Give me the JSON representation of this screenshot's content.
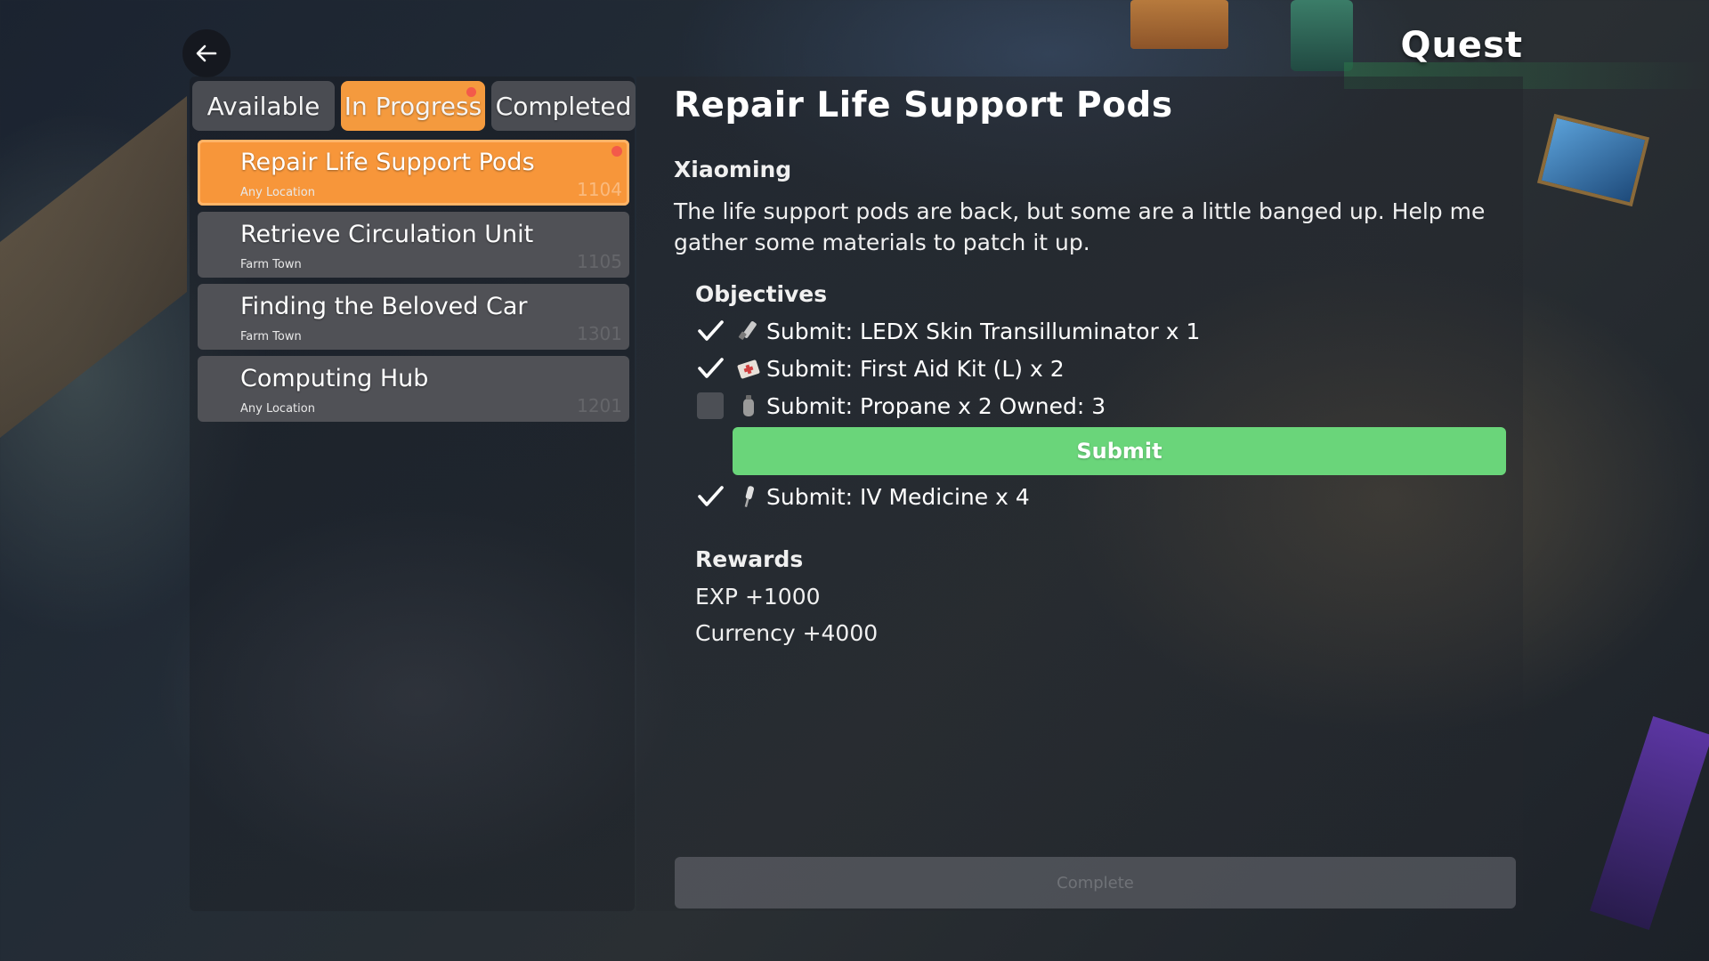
{
  "screen_title": "Quest",
  "tabs": [
    {
      "label": "Available",
      "active": false,
      "has_alert": false
    },
    {
      "label": "In Progress",
      "active": true,
      "has_alert": true
    },
    {
      "label": "Completed",
      "active": false,
      "has_alert": false
    }
  ],
  "quests": [
    {
      "name": "Repair Life Support Pods",
      "location": "Any Location",
      "code": "1104",
      "selected": true,
      "has_alert": true
    },
    {
      "name": "Retrieve Circulation Unit",
      "location": "Farm Town",
      "code": "1105",
      "selected": false,
      "has_alert": false
    },
    {
      "name": "Finding the Beloved Car",
      "location": "Farm Town",
      "code": "1301",
      "selected": false,
      "has_alert": false
    },
    {
      "name": "Computing Hub",
      "location": "Any Location",
      "code": "1201",
      "selected": false,
      "has_alert": false
    }
  ],
  "detail": {
    "title": "Repair Life Support Pods",
    "giver": "Xiaoming",
    "description": "The life support pods are back, but some are a little banged up. Help me gather some materials to patch it up.",
    "objectives_heading": "Objectives",
    "objectives": [
      {
        "text": "Submit: LEDX Skin Transilluminator x 1",
        "done": true,
        "icon": "ledx-device-icon"
      },
      {
        "text": "Submit: First Aid Kit (L) x 2",
        "done": true,
        "icon": "first-aid-kit-icon"
      },
      {
        "text": "Submit: Propane x 2 Owned: 3",
        "done": false,
        "icon": "propane-tank-icon"
      },
      {
        "text": "Submit: IV Medicine x 4",
        "done": true,
        "icon": "iv-medicine-icon"
      }
    ],
    "submit_label": "Submit",
    "rewards_heading": "Rewards",
    "rewards": [
      "EXP +1000",
      "Currency +4000"
    ],
    "complete_label": "Complete"
  },
  "colors": {
    "accent_orange": "#f7963a",
    "submit_green": "#6ad57a",
    "alert_red": "#f35a4a"
  }
}
